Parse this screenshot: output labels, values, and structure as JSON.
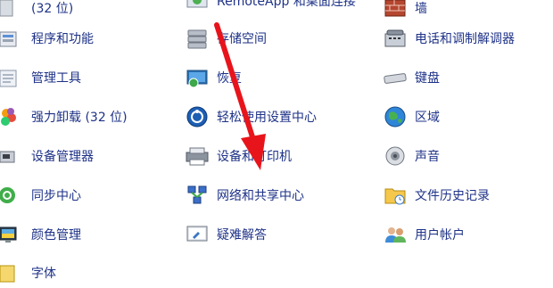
{
  "control_panel": {
    "columns": [
      {
        "items": [
          {
            "label": "(32 位)",
            "icon": "generic-app-icon"
          },
          {
            "label": "程序和功能",
            "icon": "programs-features-icon"
          },
          {
            "label": "管理工具",
            "icon": "admin-tools-icon"
          },
          {
            "label": "强力卸载 (32 位)",
            "icon": "uninstaller-icon"
          },
          {
            "label": "设备管理器",
            "icon": "device-manager-icon"
          },
          {
            "label": "同步中心",
            "icon": "sync-center-icon"
          },
          {
            "label": "颜色管理",
            "icon": "color-management-icon"
          },
          {
            "label": "字体",
            "icon": "fonts-icon"
          }
        ]
      },
      {
        "items": [
          {
            "label": "RemoteApp 和桌面连接",
            "icon": "remoteapp-icon"
          },
          {
            "label": "存储空间",
            "icon": "storage-spaces-icon"
          },
          {
            "label": "恢复",
            "icon": "recovery-icon"
          },
          {
            "label": "轻松使用设置中心",
            "icon": "ease-of-access-icon"
          },
          {
            "label": "设备和打印机",
            "icon": "devices-printers-icon"
          },
          {
            "label": "网络和共享中心",
            "icon": "network-sharing-icon"
          },
          {
            "label": "疑难解答",
            "icon": "troubleshooting-icon"
          }
        ]
      },
      {
        "items": [
          {
            "label": "墙",
            "icon": "firewall-icon"
          },
          {
            "label": "电话和调制解调器",
            "icon": "phone-modem-icon"
          },
          {
            "label": "键盘",
            "icon": "keyboard-icon"
          },
          {
            "label": "区域",
            "icon": "region-icon"
          },
          {
            "label": "声音",
            "icon": "sound-icon"
          },
          {
            "label": "文件历史记录",
            "icon": "file-history-icon"
          },
          {
            "label": "用户帐户",
            "icon": "user-accounts-icon"
          }
        ]
      }
    ]
  },
  "annotation": {
    "color": "#e8141b",
    "icon": "red-arrow-annotation"
  },
  "colors": {
    "link_text": "#1e3287",
    "background": "#ffffff"
  }
}
